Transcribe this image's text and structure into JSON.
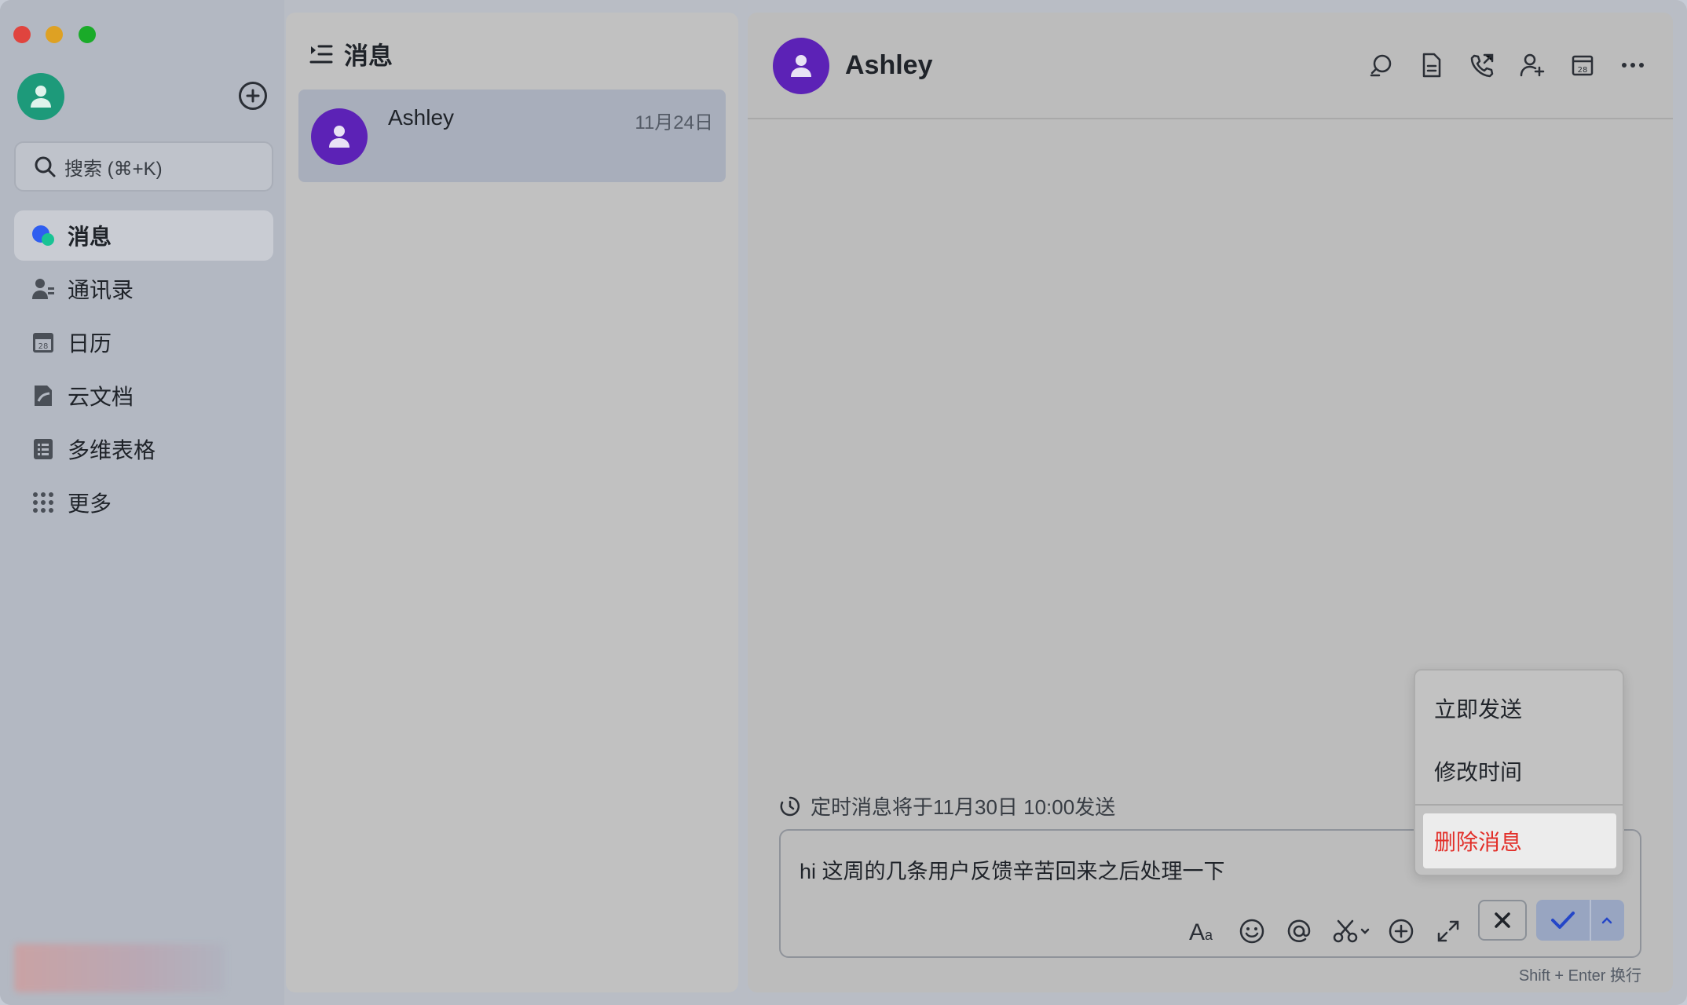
{
  "nav": {
    "search_placeholder": "搜索 (⌘+K)",
    "items": [
      {
        "label": "消息",
        "icon": "messages-icon"
      },
      {
        "label": "通讯录",
        "icon": "contacts-icon"
      },
      {
        "label": "日历",
        "icon": "calendar-icon"
      },
      {
        "label": "云文档",
        "icon": "docs-icon"
      },
      {
        "label": "多维表格",
        "icon": "base-icon"
      },
      {
        "label": "更多",
        "icon": "more-grid-icon"
      }
    ]
  },
  "list": {
    "title": "消息",
    "conversations": [
      {
        "name": "Ashley",
        "date": "11月24日"
      }
    ]
  },
  "chat": {
    "name": "Ashley",
    "scheduled_notice": "定时消息将于11月30日 10:00发送",
    "draft": "hi 这周的几条用户反馈辛苦回来之后处理一下",
    "hint": "Shift + Enter 换行"
  },
  "menu": {
    "send_now": "立即发送",
    "edit_time": "修改时间",
    "delete": "删除消息"
  },
  "colors": {
    "avatar_purple": "#5c22b6",
    "self_avatar": "#1d9a7a",
    "danger": "#e22e28"
  }
}
